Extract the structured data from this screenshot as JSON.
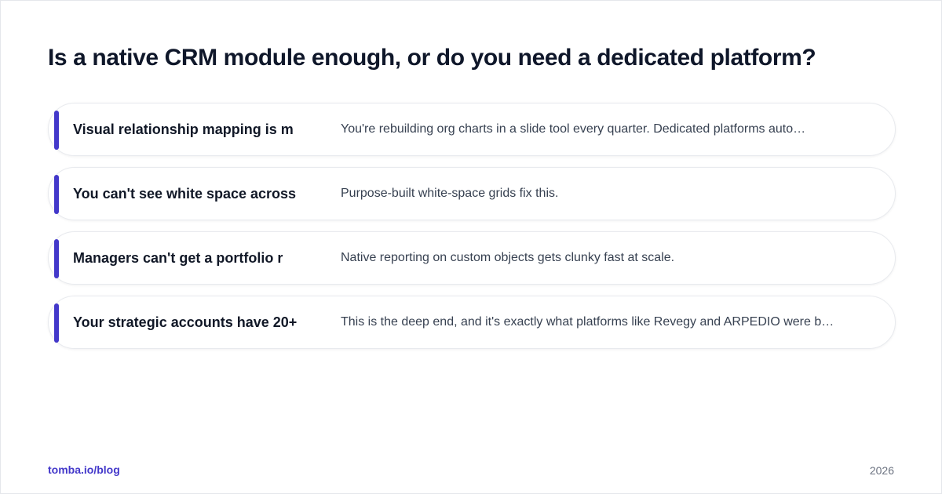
{
  "title": "Is a native CRM module enough, or do you need a dedicated platform?",
  "rows": [
    {
      "heading": "Visual relationship mapping is m",
      "description": "You're rebuilding org charts in a slide tool every quarter. Dedicated platforms auto…"
    },
    {
      "heading": "You can't see white space across",
      "description": "Purpose-built white-space grids fix this."
    },
    {
      "heading": "Managers can't get a portfolio r",
      "description": "Native reporting on custom objects gets clunky fast at scale."
    },
    {
      "heading": "Your strategic accounts have 20+",
      "description": "This is the deep end, and it's exactly what platforms like Revegy and ARPEDIO were b…"
    }
  ],
  "footer": {
    "link": "tomba.io/blog",
    "year": "2026"
  },
  "colors": {
    "accent": "#4338ca",
    "title": "#0f172a",
    "text": "#374151"
  }
}
